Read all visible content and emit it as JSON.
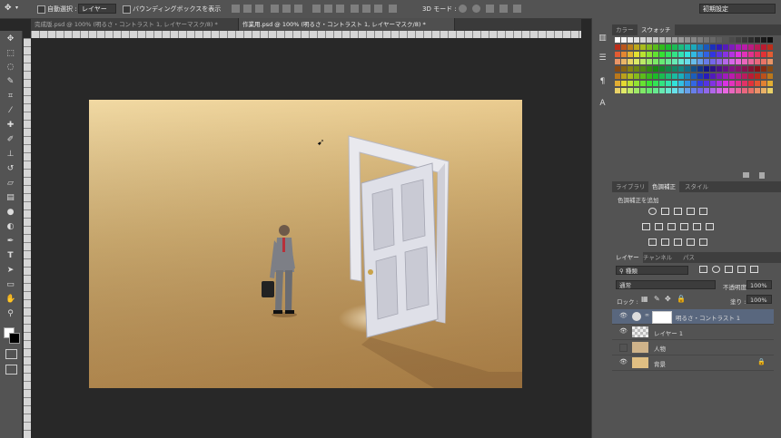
{
  "options_bar": {
    "auto_select_label": "自動選択 :",
    "auto_select_target": "レイヤー",
    "bbox_label": "バウンディングボックスを表示",
    "mode_3d_label": "3D モード :",
    "workspace": "初期設定"
  },
  "tabs": [
    {
      "label": "完成版.psd @ 100% (明るさ・コントラスト 1, レイヤーマスク/8) *",
      "close": "×",
      "active": false
    },
    {
      "label": "作業用.psd @ 100% (明るさ・コントラスト 1, レイヤーマスク/8) *",
      "close": "×",
      "active": true
    }
  ],
  "toolbar_icons": [
    "move-tool-icon",
    "marquee-tool-icon",
    "lasso-tool-icon",
    "quick-select-tool-icon",
    "crop-tool-icon",
    "eyedropper-tool-icon",
    "healing-brush-icon",
    "brush-tool-icon",
    "clone-stamp-icon",
    "history-brush-icon",
    "eraser-tool-icon",
    "gradient-tool-icon",
    "blur-tool-icon",
    "dodge-tool-icon",
    "pen-tool-icon",
    "type-tool-icon",
    "path-select-icon",
    "shape-tool-icon",
    "hand-tool-icon",
    "zoom-tool-icon"
  ],
  "type_tool_glyph": "T",
  "mini_panel": {
    "paragraph_glyph": "¶",
    "char_glyph": "A"
  },
  "swatches_panel": {
    "tabs": [
      "カラー",
      "スウォッチ"
    ],
    "active": 1
  },
  "adjustments_panel": {
    "tabs": [
      "ライブラリ",
      "色調補正",
      "スタイル"
    ],
    "active": 1,
    "title": "色調補正を追加"
  },
  "layers_panel": {
    "tabs": [
      "レイヤー",
      "チャンネル",
      "パス"
    ],
    "active": 0,
    "filter_kind": "種類",
    "blend_mode": "通常",
    "opacity_label": "不透明度 :",
    "opacity_value": "100%",
    "lock_label": "ロック :",
    "fill_label": "塗り :",
    "fill_value": "100%",
    "layers": [
      {
        "name": "明るさ・コントラスト 1",
        "visible": true,
        "selected": true,
        "type": "adjustment"
      },
      {
        "name": "レイヤー 1",
        "visible": true,
        "selected": false,
        "type": "transparent"
      },
      {
        "name": "人物",
        "visible": false,
        "selected": false,
        "type": "image"
      },
      {
        "name": "背景",
        "visible": true,
        "selected": false,
        "type": "background",
        "locked": true
      }
    ]
  },
  "colors": {
    "ui_bg": "#535353",
    "canvas_bg": "#282828",
    "selected_layer": "#59677e",
    "wood": "#e3bf7e"
  }
}
